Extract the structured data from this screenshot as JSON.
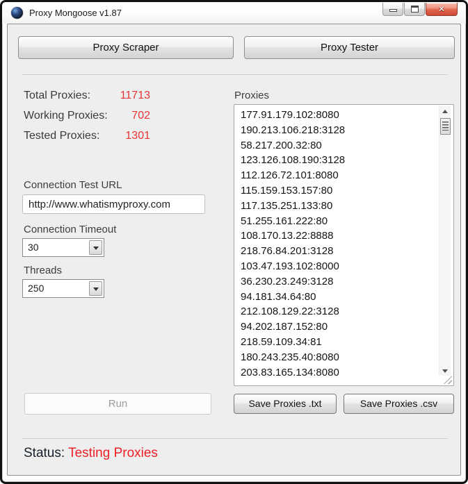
{
  "window": {
    "title": "Proxy Mongoose v1.87"
  },
  "tabs": {
    "scraper": "Proxy Scraper",
    "tester": "Proxy Tester"
  },
  "stats": {
    "rows": [
      {
        "label": "Total Proxies:",
        "value": "11713"
      },
      {
        "label": "Working Proxies:",
        "value": "702"
      },
      {
        "label": "Tested Proxies:",
        "value": "1301"
      }
    ],
    "value_color": "#e93535"
  },
  "form": {
    "url_label": "Connection Test URL",
    "url_value": "http://www.whatismyproxy.com",
    "timeout_label": "Connection Timeout",
    "timeout_value": "30",
    "threads_label": "Threads",
    "threads_value": "250"
  },
  "proxies": {
    "label": "Proxies",
    "list": [
      "177.91.179.102:8080",
      "190.213.106.218:3128",
      "58.217.200.32:80",
      "123.126.108.190:3128",
      "112.126.72.101:8080",
      "115.159.153.157:80",
      "117.135.251.133:80",
      "51.255.161.222:80",
      "108.170.13.22:8888",
      "218.76.84.201:3128",
      "103.47.193.102:8000",
      "36.230.23.249:3128",
      "94.181.34.64:80",
      "212.108.129.22:3128",
      "94.202.187.152:80",
      "218.59.109.34:81",
      "180.243.235.40:8080",
      "203.83.165.134:8080"
    ]
  },
  "actions": {
    "run": "Run",
    "save_txt": "Save Proxies .txt",
    "save_csv": "Save Proxies .csv"
  },
  "status": {
    "label": "Status:",
    "value": "Testing Proxies",
    "color": "#f01f26"
  }
}
